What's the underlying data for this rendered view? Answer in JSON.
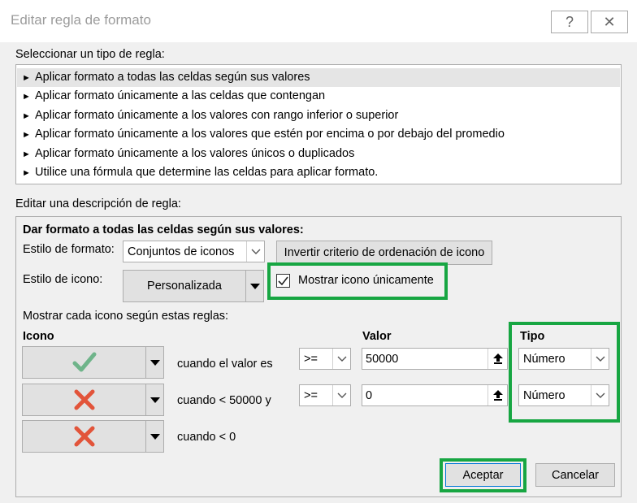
{
  "window": {
    "title": "Editar regla de formato",
    "help_glyph": "?",
    "close_glyph": "✕"
  },
  "rule_type": {
    "heading": "Seleccionar un tipo de regla:",
    "items": [
      "Aplicar formato a todas las celdas según sus valores",
      "Aplicar formato únicamente a las celdas que contengan",
      "Aplicar formato únicamente a los valores con rango inferior o superior",
      "Aplicar formato únicamente a los valores que estén por encima o por debajo del promedio",
      "Aplicar formato únicamente a los valores únicos o duplicados",
      "Utilice una fórmula que determine las celdas para aplicar formato."
    ],
    "selected_index": 0
  },
  "description": {
    "heading": "Editar una descripción de regla:",
    "group_title": "Dar formato a todas las celdas según sus valores:",
    "format_style_label": "Estilo de formato:",
    "format_style_value": "Conjuntos de iconos",
    "reverse_order_button": "Invertir criterio de ordenación de icono",
    "icon_style_label": "Estilo de icono:",
    "icon_style_value": "Personalizada",
    "show_icon_only_label": "Mostrar icono únicamente",
    "show_icon_only_checked": true,
    "rules_intro": "Mostrar cada icono según estas reglas:",
    "col_icon": "Icono",
    "col_value": "Valor",
    "col_type": "Tipo",
    "rows": [
      {
        "icon": "green-check-icon",
        "condition": "cuando el valor es",
        "operator": ">=",
        "value": "50000",
        "type": "Número"
      },
      {
        "icon": "red-x-icon",
        "condition": "cuando < 50000 y",
        "operator": ">=",
        "value": "0",
        "type": "Número"
      },
      {
        "icon": "red-x-icon",
        "condition": "cuando < 0"
      }
    ]
  },
  "buttons": {
    "ok": "Aceptar",
    "cancel": "Cancelar"
  },
  "colors": {
    "highlight": "#17a642",
    "check_green": "#6fb48a",
    "x_red": "#e2543a"
  }
}
